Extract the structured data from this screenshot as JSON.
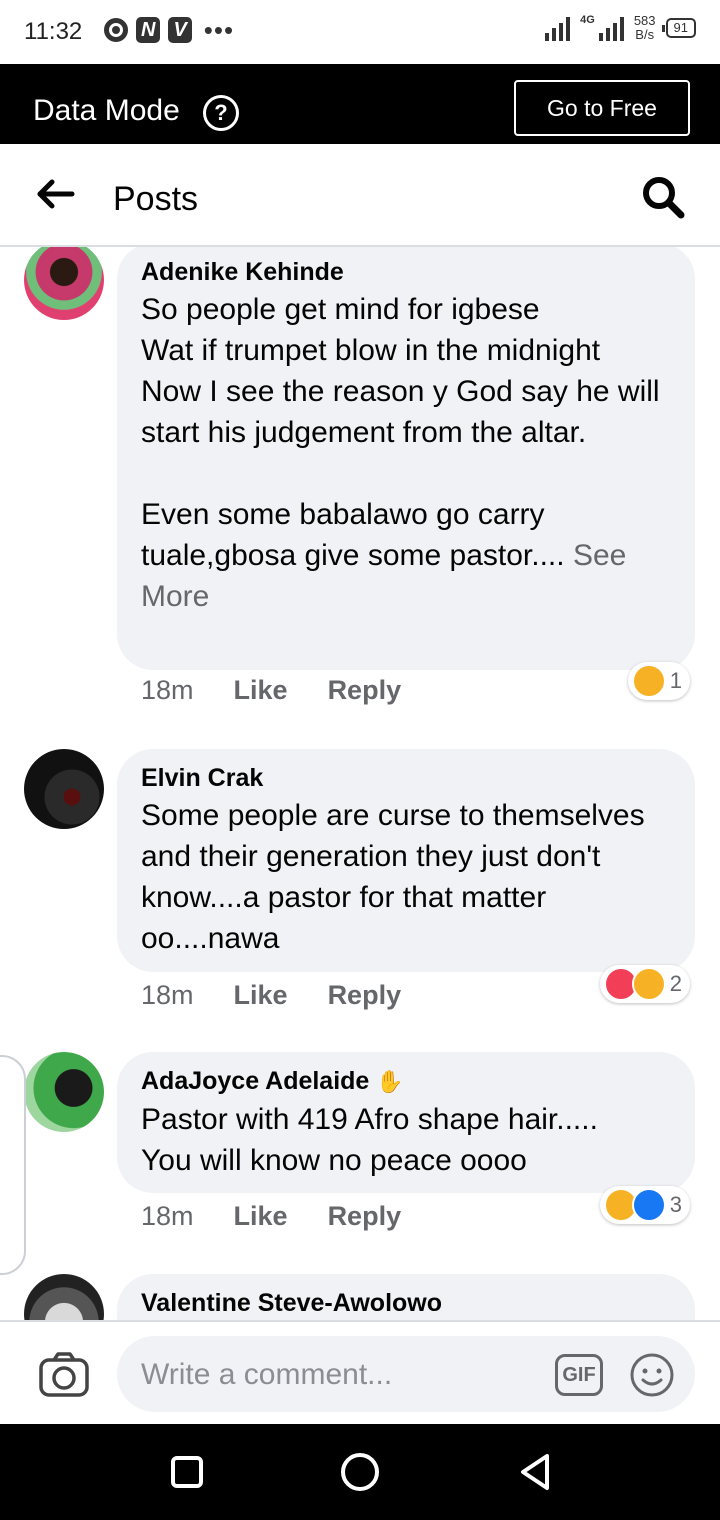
{
  "status_bar": {
    "time": "11:32",
    "badges": [
      "N",
      "V"
    ],
    "network": "4G",
    "speed_value": "583",
    "speed_unit": "B/s",
    "battery": "91"
  },
  "data_mode": {
    "title": "Data Mode",
    "button_label": "Go to Free"
  },
  "header": {
    "title": "Posts"
  },
  "comments": [
    {
      "name": "Adenike Kehinde",
      "text": "So people get mind for igbese\nWat if trumpet blow in the midnight\nNow I see the reason y God say he will start his judgement from the altar.\n\nEven some babalawo go carry tuale,gbosa give some pastor....",
      "see_more": "See More",
      "time": "18m",
      "like": "Like",
      "reply": "Reply",
      "reactions": [
        "sad"
      ],
      "reaction_count": "1"
    },
    {
      "name": "Elvin Crak",
      "text": "Some people are curse to themselves and their generation they just don't know....a pastor for that matter oo....nawa",
      "time": "18m",
      "like": "Like",
      "reply": "Reply",
      "reactions": [
        "love",
        "sad"
      ],
      "reaction_count": "2"
    },
    {
      "name": "AdaJoyce Adelaide",
      "text": "Pastor with 419 Afro shape hair.....\nYou will know no peace oooo",
      "time": "18m",
      "like": "Like",
      "reply": "Reply",
      "reactions": [
        "haha",
        "like"
      ],
      "reaction_count": "3"
    },
    {
      "name": "Valentine Steve-Awolowo"
    }
  ],
  "compose": {
    "placeholder": "Write a comment...",
    "gif_label": "GIF"
  },
  "colors": {
    "bubble_bg": "#f0f2f5",
    "secondary_text": "#65676b",
    "like_blue": "#1877f2",
    "love_red": "#f33e58",
    "emoji_yellow": "#f7b125"
  }
}
